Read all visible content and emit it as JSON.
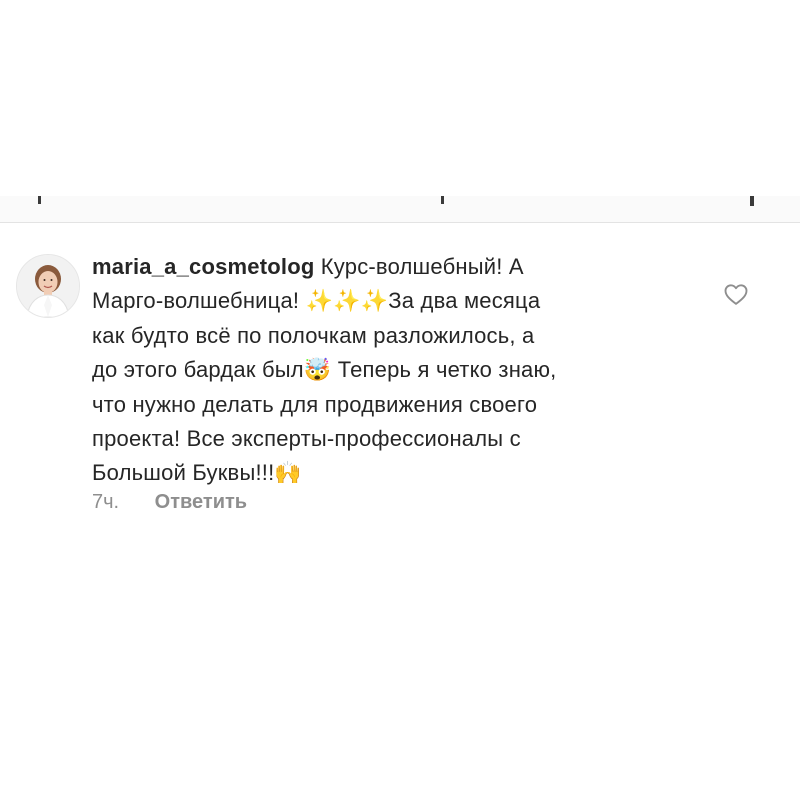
{
  "comment": {
    "username": "maria_a_cosmetolog",
    "lines": [
      {
        "text": "Курс-волшебный! А"
      },
      {
        "text": "Марго-волшебница! ",
        "emoji": "✨✨✨",
        "tail": "За два месяца"
      },
      {
        "text": "как будто всё по полочкам разложилось, а"
      },
      {
        "text": "до этого бардак был",
        "emoji": "🤯",
        "tail": " Теперь я четко знаю,"
      },
      {
        "text": "что нужно делать для продвижения своего"
      },
      {
        "text": "проекта! Все эксперты-профессионалы с"
      },
      {
        "text": "Большой Буквы!!!",
        "emoji": "🙌"
      }
    ],
    "time": "7ч.",
    "reply_label": "Ответить",
    "like_icon": "heart-outline-icon"
  },
  "colors": {
    "text": "#262626",
    "secondary": "#8e8e8e",
    "divider": "#e3e3e3"
  }
}
